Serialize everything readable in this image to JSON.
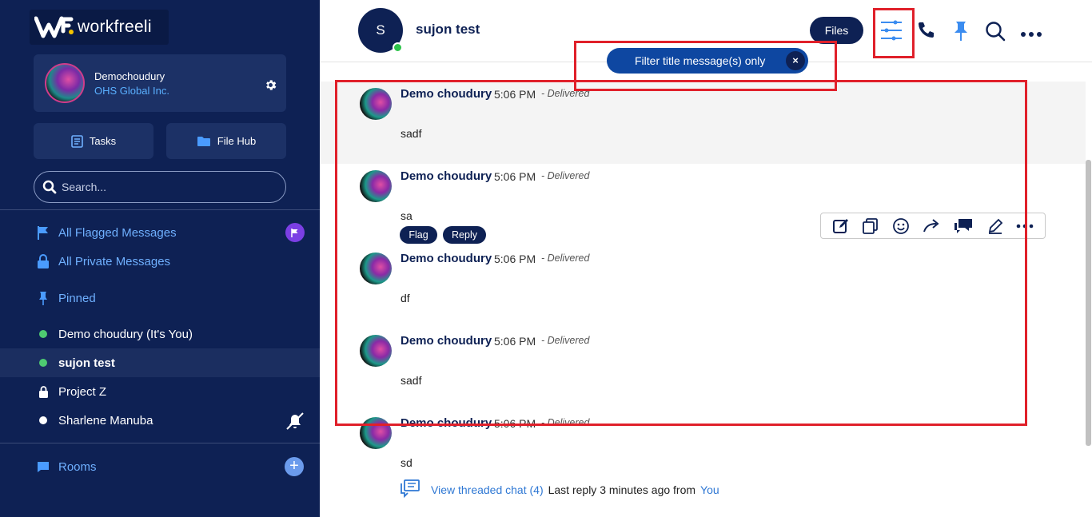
{
  "app": {
    "logo_text": "workfreeli"
  },
  "profile": {
    "name": "Demochoudury",
    "org": "OHS Global Inc."
  },
  "sidebar": {
    "tasks_label": "Tasks",
    "filehub_label": "File Hub",
    "search_placeholder": "Search...",
    "flagged_label": "All Flagged Messages",
    "private_label": "All Private Messages",
    "pinned_label": "Pinned",
    "contacts": [
      {
        "label": "Demo choudury (It's You)",
        "status": "online"
      },
      {
        "label": "sujon test",
        "status": "online",
        "active": true
      },
      {
        "label": "Project Z",
        "status": "locked"
      },
      {
        "label": "Sharlene Manuba",
        "status": "offline"
      }
    ],
    "rooms_label": "Rooms"
  },
  "header": {
    "avatar_initial": "S",
    "chat_name": "sujon test",
    "files_label": "Files",
    "icons": [
      "filter-icon",
      "phone-icon",
      "pin-icon",
      "search-icon",
      "more-icon"
    ]
  },
  "filter": {
    "label": "Filter title message(s) only",
    "close": "×"
  },
  "messages": [
    {
      "sender": "Demo choudury",
      "time": "5:06 PM",
      "status": "- Delivered",
      "text": "sadf"
    },
    {
      "sender": "Demo choudury",
      "time": "5:06 PM",
      "status": "- Delivered",
      "text": "sa",
      "flag_label": "Flag",
      "reply_label": "Reply"
    },
    {
      "sender": "Demo choudury",
      "time": "5:06 PM",
      "status": "- Delivered",
      "text": "df"
    },
    {
      "sender": "Demo choudury",
      "time": "5:06 PM",
      "status": "- Delivered",
      "text": "sadf"
    },
    {
      "sender": "Demo choudury",
      "time": "5:06 PM",
      "status": "- Delivered",
      "text": "sd"
    }
  ],
  "message_toolbar": [
    "edit-icon",
    "copy-icon",
    "emoji-icon",
    "forward-icon",
    "thread-icon",
    "pencil-icon",
    "more-icon"
  ],
  "thread": {
    "link": "View threaded chat (4)",
    "last_reply": "Last reply 3 minutes ago from",
    "from": "You"
  },
  "colors": {
    "sidebar": "#0e2154",
    "accent": "#2f78d4",
    "highlight": "#e0202a",
    "online": "#2ec44b"
  }
}
